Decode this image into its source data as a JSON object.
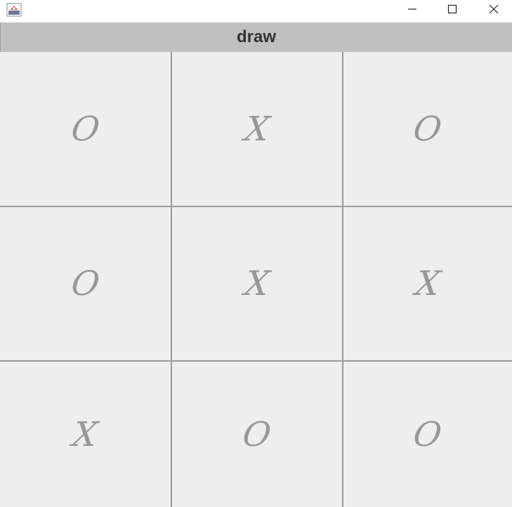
{
  "window": {
    "title": "",
    "controls": {
      "minimize_icon": "minimize-icon",
      "maximize_icon": "maximize-icon",
      "close_icon": "close-icon"
    }
  },
  "status": {
    "text": "draw"
  },
  "board": {
    "cells": [
      "O",
      "X",
      "O",
      "O",
      "X",
      "X",
      "X",
      "O",
      "O"
    ]
  },
  "colors": {
    "status_bar": "#c0c0c0",
    "grid_line": "#9a9a9a",
    "mark": "#989898",
    "cell_bg": "#eeeeee"
  }
}
